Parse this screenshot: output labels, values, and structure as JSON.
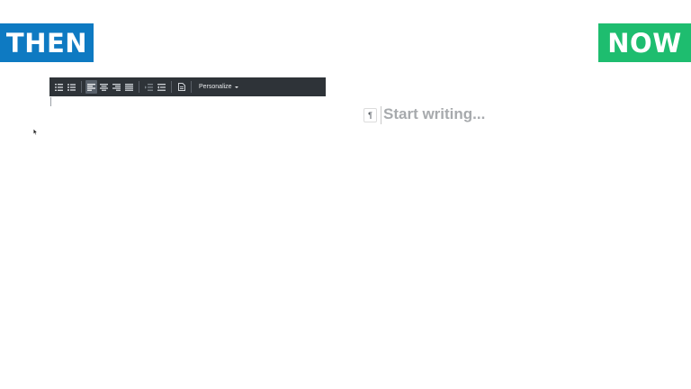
{
  "labels": {
    "then": "THEN",
    "now": "NOW"
  },
  "colors": {
    "then_badge": "#0e7ac2",
    "now_badge": "#1ebd6f",
    "toolbar_bg": "#2e3338",
    "placeholder_text": "#a7aaad"
  },
  "old_editor": {
    "toolbar": {
      "buttons": [
        {
          "icon": "numbered-list-icon",
          "active": false
        },
        {
          "icon": "bulleted-list-icon",
          "active": false
        },
        {
          "icon": "align-left-icon",
          "active": true
        },
        {
          "icon": "align-center-icon",
          "active": false
        },
        {
          "icon": "align-right-icon",
          "active": false
        },
        {
          "icon": "align-justify-icon",
          "active": false
        },
        {
          "icon": "indent-icon",
          "active": false
        },
        {
          "icon": "outdent-icon",
          "active": false
        },
        {
          "icon": "template-icon",
          "active": false
        }
      ],
      "personalize_label": "Personalize"
    }
  },
  "new_editor": {
    "block_icon": "paragraph-icon",
    "paragraph_symbol": "¶",
    "placeholder": "Start writing..."
  }
}
